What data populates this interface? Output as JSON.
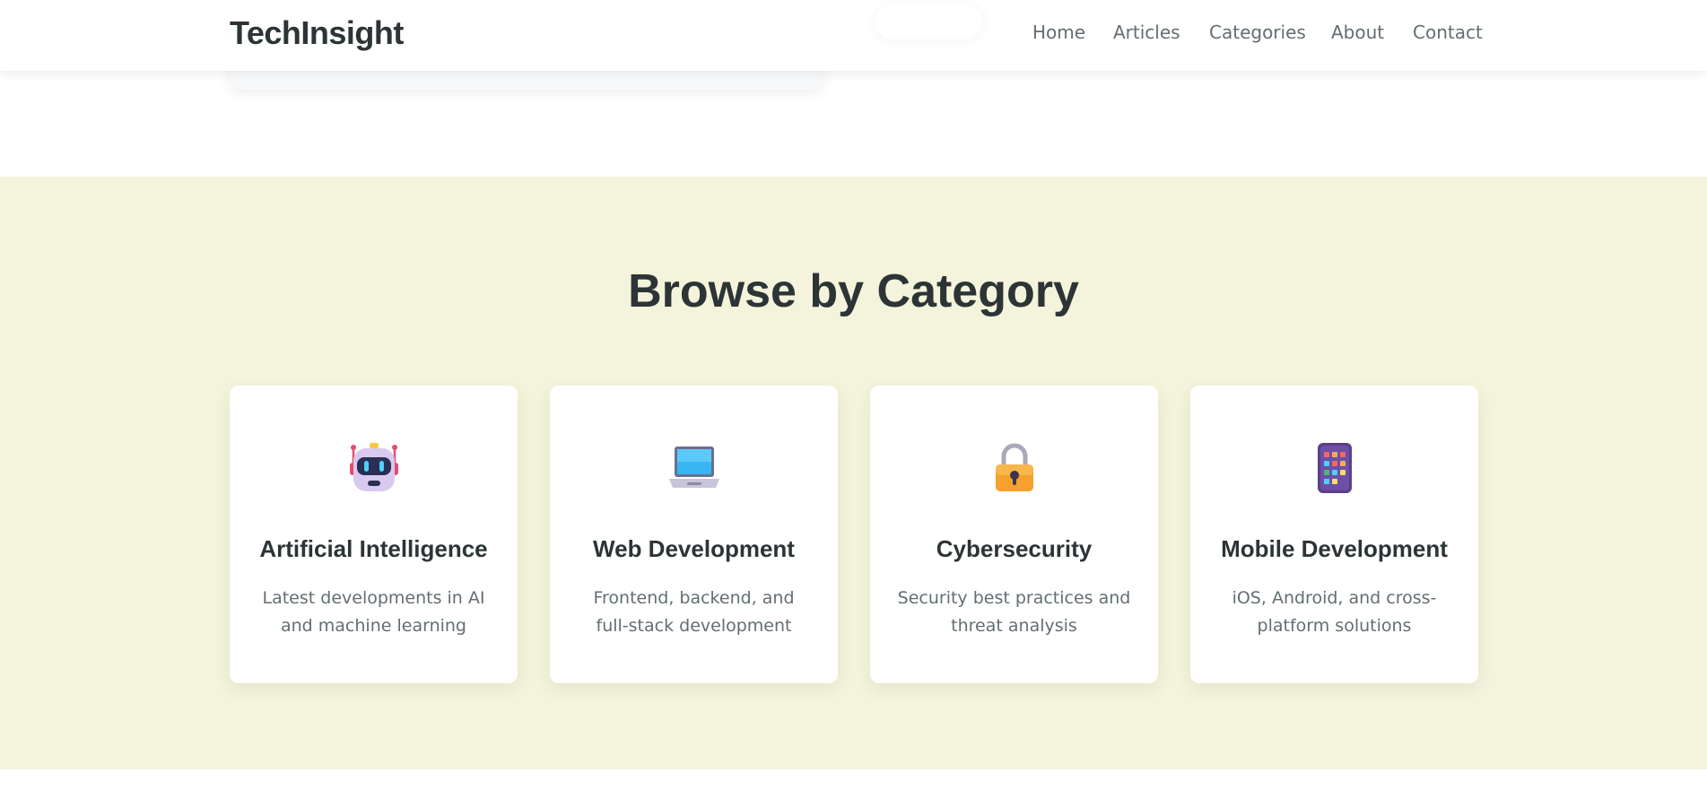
{
  "header": {
    "logo": "TechInsight",
    "nav": [
      "Home",
      "Articles",
      "Categories",
      "About",
      "Contact"
    ]
  },
  "categories": {
    "title": "Browse by Category",
    "cards": [
      {
        "icon": "robot-icon",
        "title": "Artificial Intelligence",
        "description": "Latest developments in AI and machine learning"
      },
      {
        "icon": "laptop-icon",
        "title": "Web Development",
        "description": "Frontend, backend, and full-stack development"
      },
      {
        "icon": "lock-icon",
        "title": "Cybersecurity",
        "description": "Security best practices and threat analysis"
      },
      {
        "icon": "mobile-phone-icon",
        "title": "Mobile Development",
        "description": "iOS, Android, and cross-platform solutions"
      }
    ]
  },
  "colors": {
    "section_background": "#f4f4dc",
    "heading_text": "#2d3436",
    "muted_text": "#636e72",
    "card_background": "#ffffff"
  }
}
